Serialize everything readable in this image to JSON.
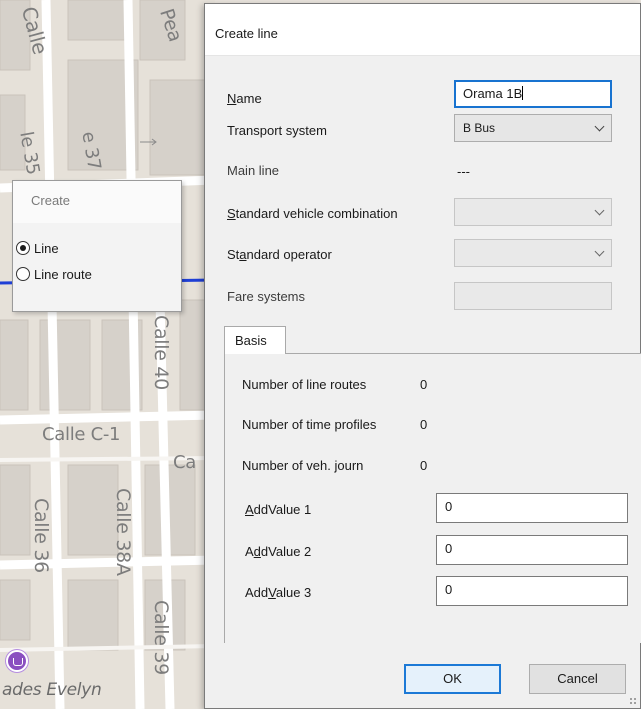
{
  "map": {
    "labels": {
      "calle_top": "Calle",
      "pea": "Pea",
      "calle_35": "le 35",
      "calle_37": "e 37",
      "calle_40": "Calle 40",
      "calle_c1": "Calle C-1",
      "ca": "Ca",
      "calle_36": "Calle 36",
      "calle_38a": "Calle 38A",
      "calle_39": "Calle 39",
      "evelyn": "ades Evelyn"
    },
    "route_color": "#1f3fd6"
  },
  "create_popup": {
    "title": "Create",
    "options": [
      {
        "label": "Line",
        "checked": true
      },
      {
        "label": "Line route",
        "checked": false
      }
    ]
  },
  "dialog": {
    "title": "Create line",
    "fields": {
      "name": {
        "label_before": "",
        "label_u": "N",
        "label_after": "ame",
        "value": "Orama 1B"
      },
      "transport_system": {
        "label": "Transport system",
        "value": "B Bus"
      },
      "main_line": {
        "label": "Main line",
        "value": "---"
      },
      "std_vehicle": {
        "label_before": "",
        "label_u": "S",
        "label_after": "tandard vehicle combination",
        "value": ""
      },
      "std_operator": {
        "label_before": "St",
        "label_u": "a",
        "label_after": "ndard operator",
        "value": ""
      },
      "fare_systems": {
        "label": "Fare systems",
        "value": ""
      }
    },
    "tab": {
      "label": "Basis"
    },
    "basis": {
      "line_routes": {
        "label": "Number of line routes",
        "value": "0"
      },
      "time_profiles": {
        "label": "Number of time profiles",
        "value": "0"
      },
      "veh_journ": {
        "label": "Number of veh. journ",
        "value": "0"
      },
      "add1": {
        "label_before": "",
        "label_u": "A",
        "label_after": "ddValue 1",
        "value": "0"
      },
      "add2": {
        "label_before": "A",
        "label_u": "d",
        "label_after": "dValue 2",
        "value": "0"
      },
      "add3": {
        "label_before": "Add",
        "label_u": "V",
        "label_after": "alue 3",
        "value": "0"
      }
    },
    "buttons": {
      "ok": "OK",
      "cancel": "Cancel"
    }
  }
}
